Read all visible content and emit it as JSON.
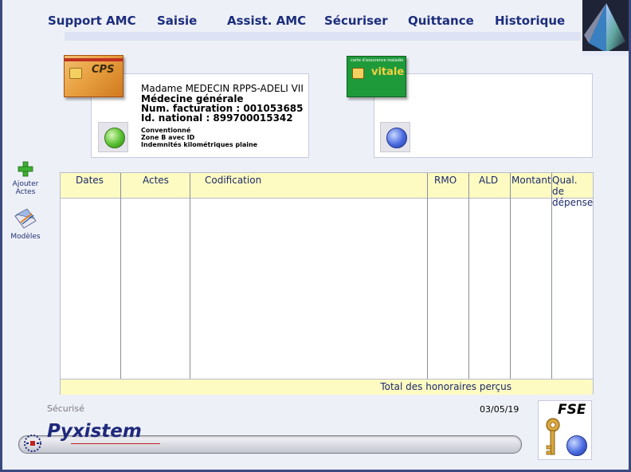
{
  "menu": {
    "items": [
      {
        "label": "Support AMC"
      },
      {
        "label": "Saisie"
      },
      {
        "label": "Assist. AMC"
      },
      {
        "label": "Sécuriser"
      },
      {
        "label": "Quittance"
      },
      {
        "label": "Historique"
      }
    ]
  },
  "ps_card": {
    "card_label": "CPS",
    "name": "Madame MEDECIN RPPS-ADELI VII",
    "specialty": "Médecine générale",
    "billing": "Num. facturation :  001053685",
    "national_id": "Id. national :  899700015342",
    "status_lines": [
      "Conventionné",
      "Zone B avec ID",
      "Indemnités kilométriques plaine"
    ],
    "status_color": "#58c030"
  },
  "vitale_card": {
    "card_label": "vitale",
    "card_header": "carte d'assurance maladie",
    "status_color": "#4a6ae0"
  },
  "side_tools": {
    "add_label_1": "Ajouter",
    "add_label_2": "Actes",
    "models_label": "Modèles"
  },
  "table": {
    "columns": [
      "Dates",
      "Actes",
      "Codification",
      "RMO",
      "ALD",
      "Montant",
      "Qual. de dépense"
    ],
    "rows": [],
    "footer": "Total des honoraires perçus"
  },
  "status": {
    "state": "Sécurisé",
    "date": "03/05/19"
  },
  "fse": {
    "label": "FSE"
  },
  "brand": {
    "name": "Pyxistem"
  },
  "colors": {
    "menu_text": "#1c2e7c",
    "table_header_bg": "#fdfbc2",
    "background": "#eef0f8"
  }
}
